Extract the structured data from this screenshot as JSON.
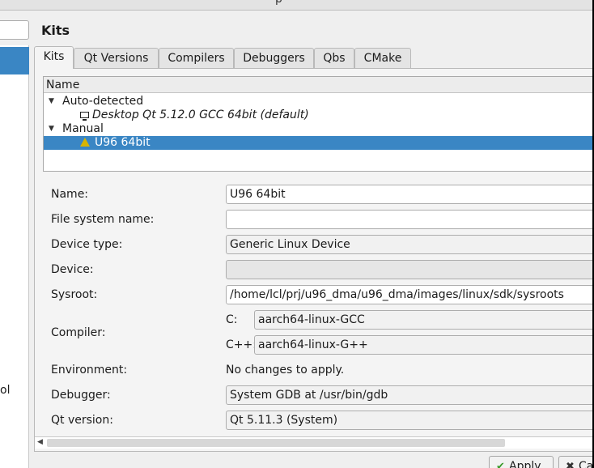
{
  "window": {
    "title_fragment": "p"
  },
  "page": {
    "title": "Kits"
  },
  "left_panel": {
    "visible_item_fragment": "ol"
  },
  "tabs": [
    {
      "label": "Kits",
      "active": true
    },
    {
      "label": "Qt Versions"
    },
    {
      "label": "Compilers"
    },
    {
      "label": "Debuggers"
    },
    {
      "label": "Qbs"
    },
    {
      "label": "CMake"
    }
  ],
  "kit_tree": {
    "header": "Name",
    "groups": [
      {
        "label": "Auto-detected",
        "items": [
          {
            "label": "Desktop Qt 5.12.0 GCC 64bit (default)",
            "icon": "monitor-icon"
          }
        ]
      },
      {
        "label": "Manual",
        "items": [
          {
            "label": "U96 64bit",
            "icon": "warning-icon",
            "selected": true
          }
        ]
      }
    ]
  },
  "form": {
    "name": {
      "label": "Name:",
      "value": "U96 64bit"
    },
    "fs_name": {
      "label": "File system name:",
      "value": ""
    },
    "device_type": {
      "label": "Device type:",
      "value": "Generic Linux Device"
    },
    "device": {
      "label": "Device:",
      "value": ""
    },
    "sysroot": {
      "label": "Sysroot:",
      "value": "/home/lcl/prj/u96_dma/u96_dma/images/linux/sdk/sysroots"
    },
    "compiler": {
      "label": "Compiler:",
      "c_label": "C:",
      "c_value": "aarch64-linux-GCC",
      "cpp_label": "C++:",
      "cpp_value": "aarch64-linux-G++"
    },
    "environment": {
      "label": "Environment:",
      "value": "No changes to apply."
    },
    "debugger": {
      "label": "Debugger:",
      "value": "System GDB at /usr/bin/gdb"
    },
    "qt_version": {
      "label": "Qt version:",
      "value": "Qt 5.11.3 (System)"
    }
  },
  "buttons": {
    "apply": "Apply",
    "cancel": "Ca"
  },
  "colors": {
    "selection": "#3a86c4",
    "warning": "#d8b400"
  }
}
